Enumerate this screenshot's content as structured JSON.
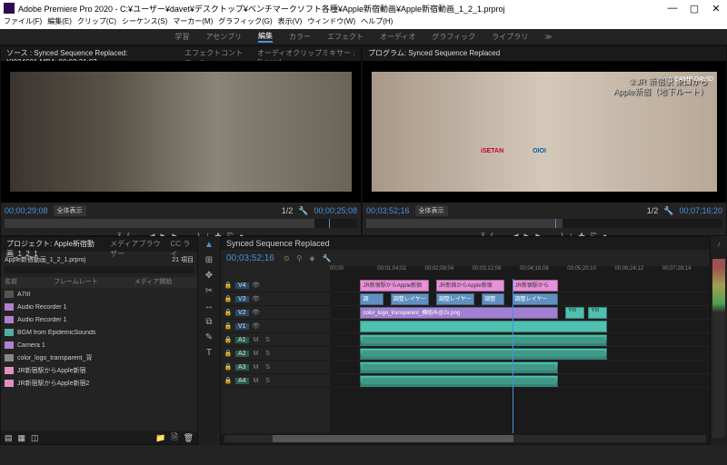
{
  "title": "Adobe Premiere Pro 2020 - C:¥ユーザー¥davet¥デスクトップ¥ベンチマークソフト各種¥Apple新宿動画¥Apple新宿動画_1_2_1.prproj",
  "menu": [
    "ファイル(F)",
    "編集(E)",
    "クリップ(C)",
    "シーケンス(S)",
    "マーカー(M)",
    "グラフィック(G)",
    "表示(V)",
    "ウィンドウ(W)",
    "ヘルプ(H)"
  ],
  "workspaces": {
    "items": [
      "学習",
      "アセンブリ",
      "編集",
      "カラー",
      "エフェクト",
      "オーディオ",
      "グラフィック",
      "ライブラリ"
    ],
    "active": "編集"
  },
  "source": {
    "tabs": [
      "ソース : Synced Sequence Replaced: YI034601.MP4: 00;02;31;07",
      "エフェクトコントロール",
      "オーディオクリップミキサー : Synced"
    ],
    "tc_in": "00;00;29;08",
    "tc_out": "00;00;25;08",
    "zoom": "全体表示",
    "ratio": "1/2"
  },
  "program": {
    "tab": "プログラム: Synced Sequence Replaced",
    "overlay_line1": "②JR 新宿駅 東口から",
    "overlay_line2": "Apple新宿（地下ルート）",
    "logo": "△ CAMP DAVID",
    "sign1": "iSETAN",
    "sign2": "OIOI",
    "tc_in": "00;03;52;16",
    "tc_out": "00;07;16;20",
    "zoom": "全体表示",
    "ratio": "1/2"
  },
  "transport_icons": [
    "⤒",
    "{",
    "←",
    "◀",
    "▶",
    "▶",
    "→",
    "}",
    "⤓",
    "✚",
    "⎘",
    "●"
  ],
  "project": {
    "tabs": [
      "プロジェクト: Apple新宿動画_1_2_1",
      "メディアブラウザー",
      "CC ライ"
    ],
    "filename": "Apple新宿動画_1_2_1.prproj",
    "count": "21 項目",
    "cols": [
      "名前",
      "フレームレート",
      "メディア開始"
    ],
    "items": [
      {
        "c": "folder",
        "n": "A7III"
      },
      {
        "c": "violet",
        "n": "Audio Recorder 1"
      },
      {
        "c": "violet",
        "n": "Audio Recorder 1"
      },
      {
        "c": "teal",
        "n": "BGM from EpidemicSounds"
      },
      {
        "c": "violet",
        "n": "Camera 1"
      },
      {
        "c": "seq",
        "n": "color_logo_transparent_背"
      },
      {
        "c": "pink",
        "n": "JR新宿駅からApple新宿"
      },
      {
        "c": "pink",
        "n": "JR新宿駅からApple新宿2"
      }
    ]
  },
  "tools": [
    "▲",
    "⊞",
    "✥",
    "✂",
    "↔",
    "⧉",
    "✎",
    "T"
  ],
  "timeline": {
    "tab": "Synced Sequence Replaced",
    "tc": "00;03;52;16",
    "ruler": [
      "00;00",
      "00;01;04;02",
      "00;02;08;04",
      "00;03;12;06",
      "00;04;16;08",
      "00;05;20;10",
      "00;06;24;12",
      "00;07;28;14"
    ],
    "video_tracks": [
      "V4",
      "V3",
      "V2",
      "V1"
    ],
    "audio_tracks": [
      "A1",
      "A2",
      "A3",
      "A4"
    ],
    "th_icons": [
      "🔒",
      "👁",
      "M",
      "S"
    ],
    "clips_v4": [
      {
        "l": 8,
        "w": 18,
        "c": "pink",
        "t": "JR新宿駅からApple新宿"
      },
      {
        "l": 28,
        "w": 18,
        "c": "pink",
        "t": "JR新宿からApple新宿"
      },
      {
        "l": 48,
        "w": 12,
        "c": "pink",
        "t": "JR新宿駅から"
      }
    ],
    "clips_v3": [
      {
        "l": 8,
        "w": 6,
        "c": "blue",
        "t": "調"
      },
      {
        "l": 16,
        "w": 10,
        "c": "blue",
        "t": "調整レイヤー"
      },
      {
        "l": 28,
        "w": 10,
        "c": "blue",
        "t": "調整レイヤー"
      },
      {
        "l": 40,
        "w": 6,
        "c": "blue",
        "t": "調整"
      },
      {
        "l": 48,
        "w": 12,
        "c": "blue",
        "t": "調整レイヤー"
      }
    ],
    "clips_v2": [
      {
        "l": 8,
        "w": 52,
        "c": "violet",
        "t": "color_logo_transparent_横組み@2x.png"
      },
      {
        "l": 62,
        "w": 5,
        "c": "teal",
        "t": "YI0"
      },
      {
        "l": 68,
        "w": 5,
        "c": "teal",
        "t": "YI0"
      }
    ],
    "clips_v1": [
      {
        "l": 8,
        "w": 65,
        "c": "teal",
        "t": ""
      }
    ]
  }
}
